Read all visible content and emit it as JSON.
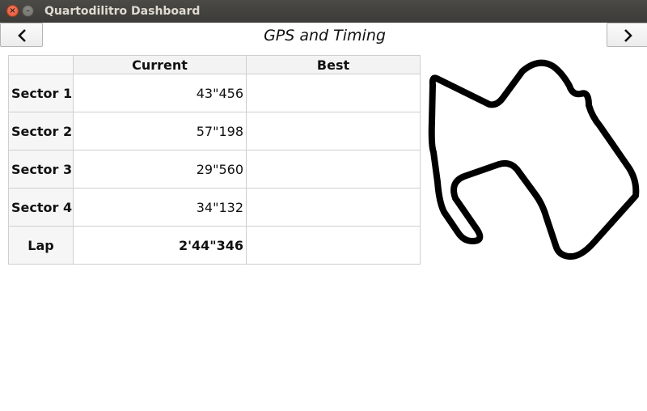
{
  "window": {
    "title": "Quartodilitro Dashboard",
    "close_icon": "close-icon",
    "minimize_icon": "minimize-icon"
  },
  "header": {
    "title": "GPS and Timing",
    "prev_icon": "chevron-left-icon",
    "next_icon": "chevron-right-icon"
  },
  "table": {
    "columns": [
      "Current",
      "Best"
    ],
    "rows": [
      {
        "label": "Sector 1",
        "current": "43\"456",
        "best": ""
      },
      {
        "label": "Sector 2",
        "current": "57\"198",
        "best": ""
      },
      {
        "label": "Sector 3",
        "current": "29\"560",
        "best": ""
      },
      {
        "label": "Sector 4",
        "current": "34\"132",
        "best": ""
      },
      {
        "label": "Lap",
        "current": "2'44\"346",
        "best": ""
      }
    ]
  },
  "track_map": {
    "stroke_color": "#000000"
  }
}
